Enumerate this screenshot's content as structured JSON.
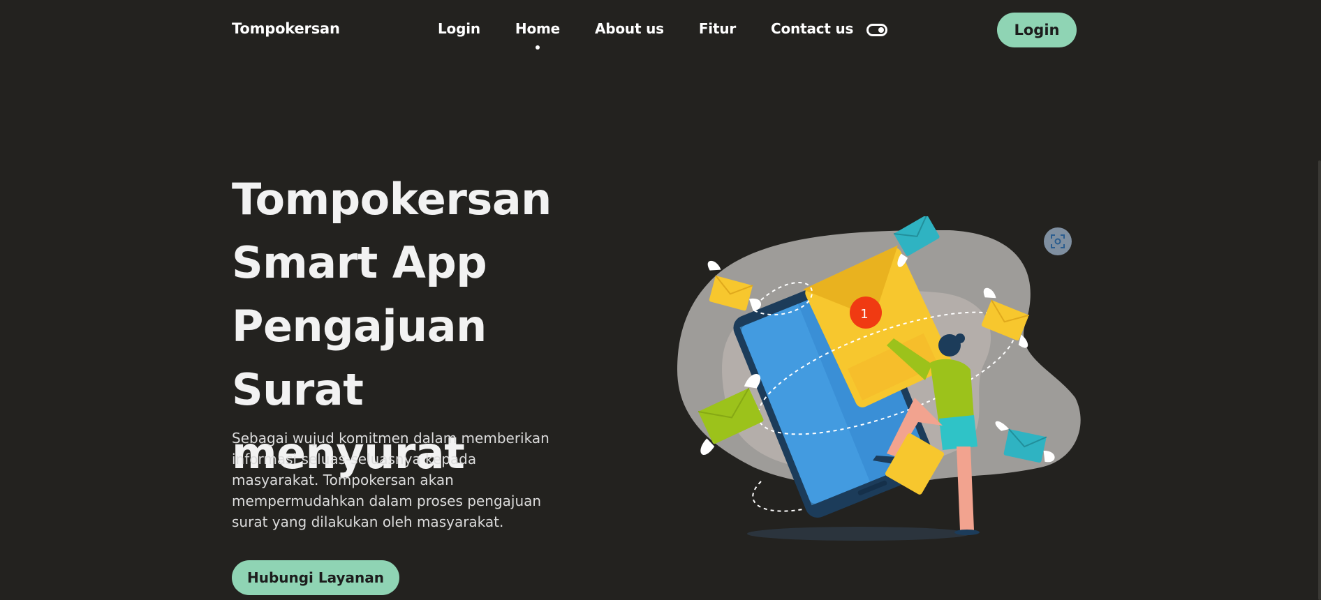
{
  "header": {
    "brand": "Tompokersan",
    "nav": [
      {
        "label": "Login"
      },
      {
        "label": "Home",
        "active": true
      },
      {
        "label": "About us"
      },
      {
        "label": "Fitur"
      },
      {
        "label": "Contact us"
      }
    ],
    "toggle_icon": "dark-mode-toggle-icon",
    "login_label": "Login"
  },
  "hero": {
    "title_lines": [
      "Tompokersan",
      "Smart App",
      "Pengajuan Surat",
      "menyurat"
    ],
    "description": "Sebagai wujud komitmen dalam memberikan informasi seluas-seluasnya kepada masyarakat. Tompokersan akan mempermudahkan dalam proses pengajuan surat yang dilakukan oleh masyarakat.",
    "cta_label": "Hubungi Layanan",
    "notification_count": "1"
  },
  "colors": {
    "background": "#23221f",
    "accent": "#8fd4b4",
    "blob": "#9e9c99",
    "phone": "#3a8fd6",
    "envelope_yellow": "#f7c72e",
    "envelope_teal": "#2fb3c2",
    "envelope_green": "#9cc21b",
    "badge": "#f03a12"
  }
}
